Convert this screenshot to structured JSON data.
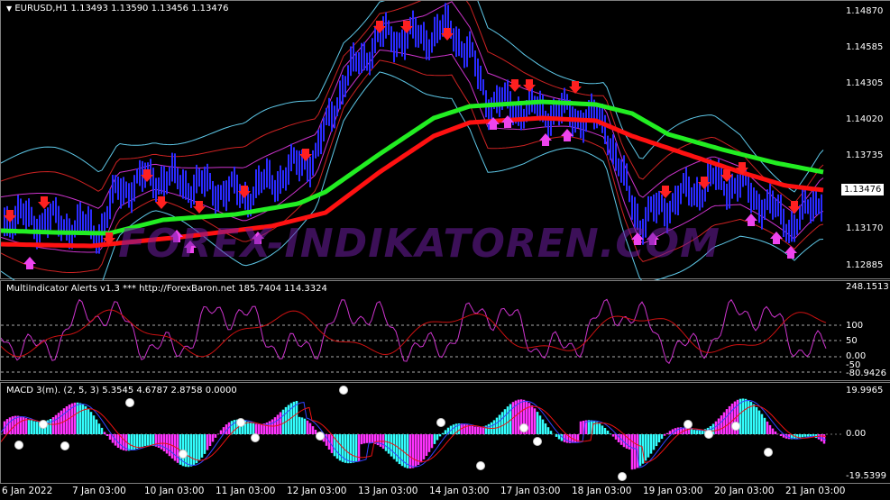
{
  "main": {
    "title": "EURUSD,H1  1.13493 1.13590 1.13456 1.13476",
    "prices": [
      "1.14870",
      "1.14585",
      "1.14305",
      "1.14020",
      "1.13735",
      "1.13170",
      "1.12885"
    ],
    "current_price": "1.13476",
    "watermark": "FOREX-INDIKATOREN.COM",
    "colors": {
      "candles": "#2a2aff",
      "ma_fast": "#22ee22",
      "ma_slow": "#ff1111",
      "bands_outer": "#5ec8e8",
      "bands_mid": "#cc2222",
      "bands_inner": "#cc33cc",
      "arrow_down": "#ff2020",
      "arrow_up": "#ee44ee"
    }
  },
  "multi": {
    "title": "MultiIndicator Alerts v1.3 *** http://ForexBaron.net 185.7404 114.3324",
    "levels": [
      "248.1513",
      "100",
      "50",
      "0.00",
      "-50",
      "-80.9426"
    ]
  },
  "macd": {
    "title": "MACD 3(m). (2, 5, 3) 5.3545 4.6787 2.8758 0.0000",
    "levels": [
      "19.9965",
      "0.00",
      "-19.5399"
    ]
  },
  "time_labels": [
    "6 Jan 2022",
    "7 Jan 03:00",
    "10 Jan 03:00",
    "11 Jan 03:00",
    "12 Jan 03:00",
    "13 Jan 03:00",
    "14 Jan 03:00",
    "17 Jan 03:00",
    "18 Jan 03:00",
    "19 Jan 03:00",
    "20 Jan 03:00",
    "21 Jan 03:00"
  ]
}
